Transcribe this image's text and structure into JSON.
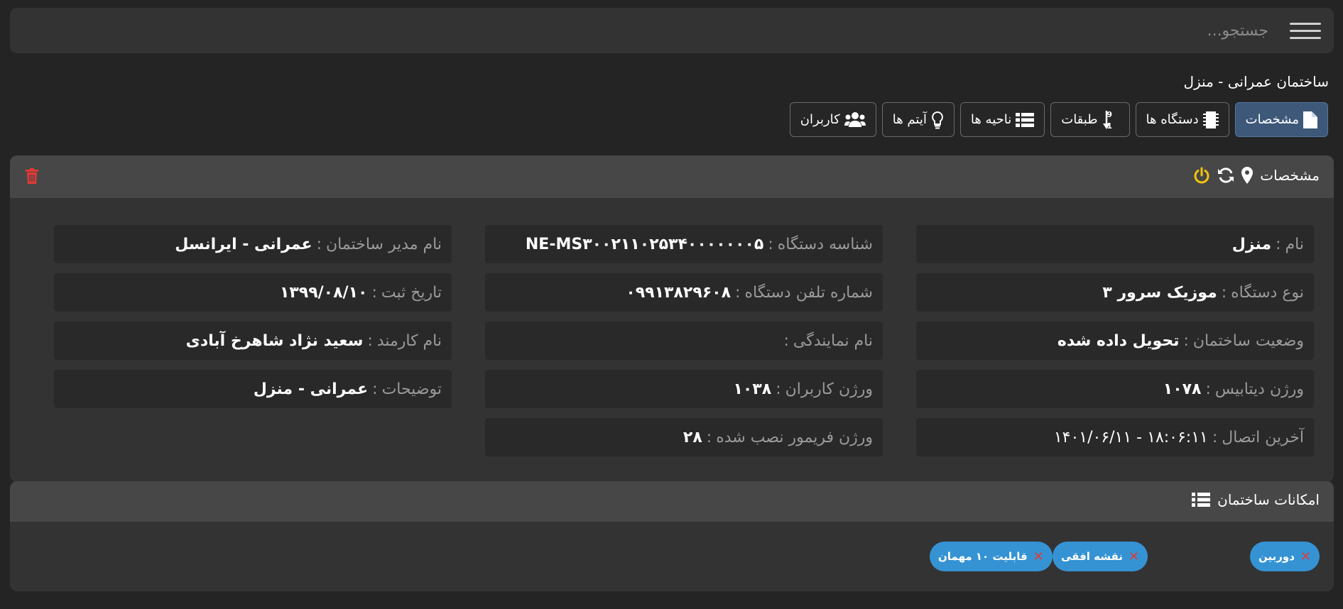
{
  "search": {
    "placeholder": "جستجو..."
  },
  "building_title": "ساختمان عمرانی - منزل",
  "tabs": [
    {
      "label": "مشخصات",
      "icon": "file-icon",
      "active": true
    },
    {
      "label": "دستگاه ها",
      "icon": "chip-icon",
      "active": false
    },
    {
      "label": "طبقات",
      "icon": "sort-numeric-icon",
      "active": false
    },
    {
      "label": "ناحیه ها",
      "icon": "list-icon",
      "active": false
    },
    {
      "label": "آیتم ها",
      "icon": "lightbulb-icon",
      "active": false
    },
    {
      "label": "کاربران",
      "icon": "users-icon",
      "active": false
    }
  ],
  "details": {
    "title": "مشخصات",
    "fields": {
      "name": {
        "label": "نام",
        "value": "منزل"
      },
      "device_type": {
        "label": "نوع دستگاه",
        "value": "موزیک سرور ۳"
      },
      "building_status": {
        "label": "وضعیت ساختمان",
        "value": "تحویل داده شده"
      },
      "db_version": {
        "label": "ورژن دیتابیس",
        "value": "۱۰۷۸"
      },
      "last_connection": {
        "label": "آخرین اتصال",
        "value": "۱۸:۰۶:۱۱ - ۱۴۰۱/۰۶/۱۱"
      },
      "device_id": {
        "label": "شناسه دستگاه",
        "value": "NE-MS۳۰۰۲۱۱۰۲۵۳۴۰۰۰۰۰۰۰۵"
      },
      "device_phone": {
        "label": "شماره تلفن دستگاه",
        "value": "۰۹۹۱۳۸۲۹۶۰۸"
      },
      "agency_name": {
        "label": "نام نمایندگی",
        "value": ""
      },
      "users_version": {
        "label": "ورژن کاربران",
        "value": "۱۰۳۸"
      },
      "firmware_version": {
        "label": "ورژن فریمور نصب شده",
        "value": "۲۸"
      },
      "manager_name": {
        "label": "نام مدیر ساختمان",
        "value": "عمرانی - ایرانسل"
      },
      "register_date": {
        "label": "تاریخ ثبت",
        "value": "۱۳۹۹/۰۸/۱۰"
      },
      "employee_name": {
        "label": "نام کارمند",
        "value": "سعید نژاد شاهرخ آبادی"
      },
      "description": {
        "label": "توضیحات",
        "value": "عمرانی - منزل"
      }
    }
  },
  "features": {
    "title": "امکانات ساختمان",
    "chips": [
      "دوربین",
      "نقشه افقی",
      "قابلیت ۱۰ مهمان"
    ]
  },
  "colors": {
    "accent": "#3593d4",
    "power": "#f2c40f",
    "delete": "#e53935",
    "active_tab": "#3d5879"
  }
}
